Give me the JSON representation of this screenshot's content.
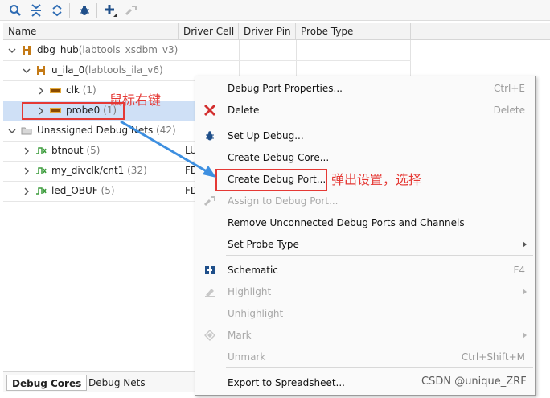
{
  "columns": [
    "Name",
    "Driver Cell",
    "Driver Pin",
    "Probe Type"
  ],
  "tree": [
    {
      "indent": 0,
      "expanded": true,
      "icon": "hub-icon",
      "label": "dbg_hub",
      "sub": "(labtools_xsdbm_v3)",
      "driver": ""
    },
    {
      "indent": 1,
      "expanded": true,
      "icon": "hub-icon",
      "label": "u_ila_0",
      "sub": "(labtools_ila_v6)",
      "driver": ""
    },
    {
      "indent": 2,
      "expanded": false,
      "icon": "port-icon",
      "label": "clk",
      "sub": " (1)",
      "driver": ""
    },
    {
      "indent": 2,
      "expanded": false,
      "icon": "port-icon",
      "label": "probe0",
      "sub": " (1)",
      "driver": "",
      "selected": true
    },
    {
      "indent": 0,
      "expanded": true,
      "icon": "folder-icon",
      "label": "Unassigned Debug Nets",
      "sub": " (42)",
      "driver": ""
    },
    {
      "indent": 1,
      "expanded": false,
      "icon": "net-icon",
      "label": "btnout",
      "sub": " (5)",
      "driver": "LU"
    },
    {
      "indent": 1,
      "expanded": false,
      "icon": "net-icon",
      "label": "my_divclk/cnt1",
      "sub": " (32)",
      "driver": "FD"
    },
    {
      "indent": 1,
      "expanded": false,
      "icon": "net-icon",
      "label": "led_OBUF",
      "sub": " (5)",
      "driver": "FD"
    }
  ],
  "tabs": [
    "Debug Cores",
    "Debug Nets"
  ],
  "menu": [
    {
      "label": "Debug Port Properties...",
      "shortcut": "Ctrl+E",
      "icon": "",
      "disabled": false
    },
    {
      "label": "Delete",
      "shortcut": "Delete",
      "icon": "delete-icon",
      "disabled": false
    },
    {
      "label": "Set Up Debug...",
      "shortcut": "",
      "icon": "bug-icon",
      "disabled": false
    },
    {
      "label": "Create Debug Core...",
      "shortcut": "",
      "icon": "",
      "disabled": false
    },
    {
      "label": "Create Debug Port...",
      "shortcut": "",
      "icon": "",
      "disabled": false
    },
    {
      "label": "Assign to Debug Port...",
      "shortcut": "",
      "icon": "assign-icon",
      "disabled": true
    },
    {
      "label": "Remove Unconnected Debug Ports and Channels",
      "shortcut": "",
      "icon": "",
      "disabled": false
    },
    {
      "label": "Set Probe Type",
      "shortcut": "",
      "icon": "",
      "disabled": false,
      "submenu": true
    },
    {
      "label": "Schematic",
      "shortcut": "F4",
      "icon": "schematic-icon",
      "disabled": false
    },
    {
      "label": "Highlight",
      "shortcut": "",
      "icon": "highlight-icon",
      "disabled": true,
      "submenu": true
    },
    {
      "label": "Unhighlight",
      "shortcut": "",
      "icon": "",
      "disabled": true
    },
    {
      "label": "Mark",
      "shortcut": "",
      "icon": "mark-icon",
      "disabled": true,
      "submenu": true
    },
    {
      "label": "Unmark",
      "shortcut": "Ctrl+Shift+M",
      "icon": "",
      "disabled": true
    },
    {
      "label": "Export to Spreadsheet...",
      "shortcut": "",
      "icon": "",
      "disabled": false
    }
  ],
  "annotations": {
    "right_click": "鼠标右键",
    "popup": "弹出设置，选择"
  },
  "watermark": "CSDN @unique_ZRF",
  "colors": {
    "accent": "#e53935",
    "selection": "#cfe0f6",
    "arrow": "#3d8fe0"
  }
}
